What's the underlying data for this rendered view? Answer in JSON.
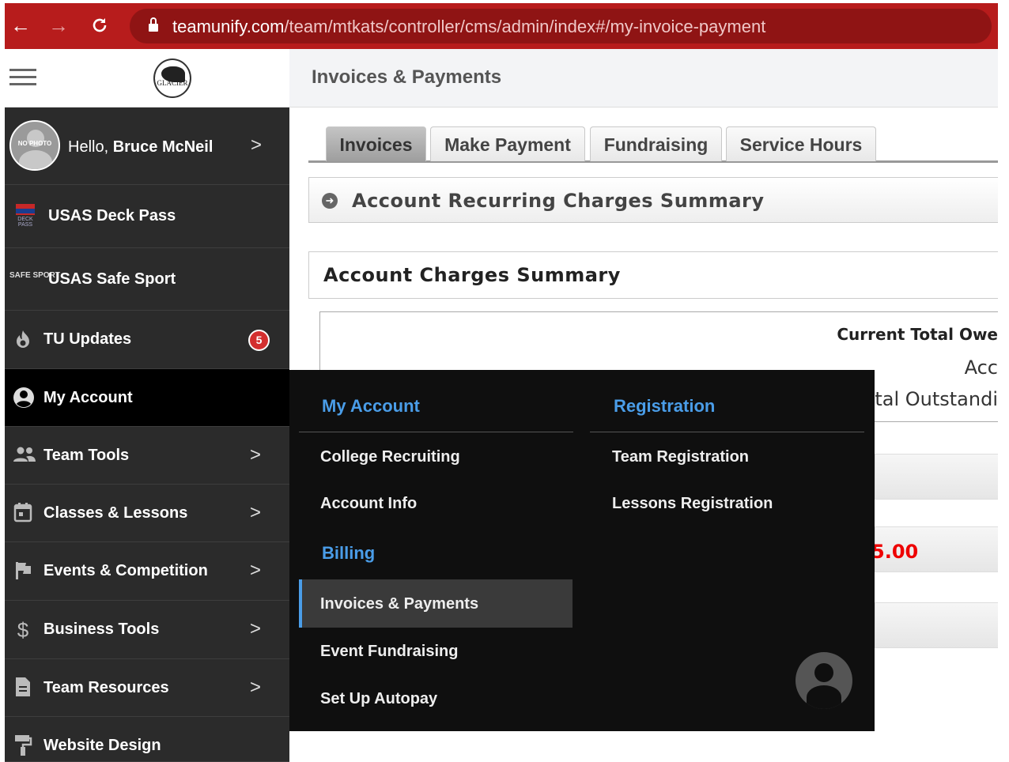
{
  "browser": {
    "url_host": "teamunify.com",
    "url_path": "/team/mtkats/controller/cms/admin/index#/my-invoice-payment",
    "back_icon": "←",
    "forward_icon": "→",
    "reload_icon": "C"
  },
  "sidebar": {
    "team_logo_text": "GLACIER",
    "user": {
      "greeting": "Hello,",
      "name": "Bruce McNeil",
      "avatar_text": "NO PHOTO"
    },
    "items": [
      {
        "label": "USAS Deck Pass",
        "icon": "deck-pass-icon",
        "icon_text": "DECK PASS"
      },
      {
        "label": "USAS Safe Sport",
        "icon": "safe-sport-icon",
        "icon_text": "SAFE SPORT"
      },
      {
        "label": "TU Updates",
        "icon": "flame-icon",
        "badge": "5"
      },
      {
        "label": "My Account",
        "icon": "account-circle-icon"
      },
      {
        "label": "Team Tools",
        "icon": "people-icon"
      },
      {
        "label": "Classes & Lessons",
        "icon": "calendar-icon"
      },
      {
        "label": "Events & Competition",
        "icon": "flag-icon"
      },
      {
        "label": "Business Tools",
        "icon": "dollar-icon"
      },
      {
        "label": "Team Resources",
        "icon": "document-icon"
      },
      {
        "label": "Website Design",
        "icon": "paint-roller-icon"
      }
    ],
    "chevron": ">"
  },
  "main": {
    "page_title": "Invoices & Payments",
    "tabs": [
      {
        "label": "Invoices",
        "active": true
      },
      {
        "label": "Make Payment",
        "active": false
      },
      {
        "label": "Fundraising",
        "active": false
      },
      {
        "label": "Service Hours",
        "active": false
      }
    ],
    "recurring_title": "Account Recurring Charges Summary",
    "charges_title": "Account Charges Summary",
    "current_total_label": "Current Total Owe",
    "account_label": "Acc",
    "outstanding_label": "tal Outstandi",
    "amount": "5.00",
    "amount_color": "#e00000"
  },
  "flyout": {
    "my_account_heading": "My Account",
    "my_account_links": [
      "College Recruiting",
      "Account Info"
    ],
    "billing_heading": "Billing",
    "billing_links": [
      "Invoices & Payments",
      "Event Fundraising",
      "Set Up Autopay"
    ],
    "registration_heading": "Registration",
    "registration_links": [
      "Team Registration",
      "Lessons Registration"
    ],
    "accent": "#4a9de8"
  }
}
